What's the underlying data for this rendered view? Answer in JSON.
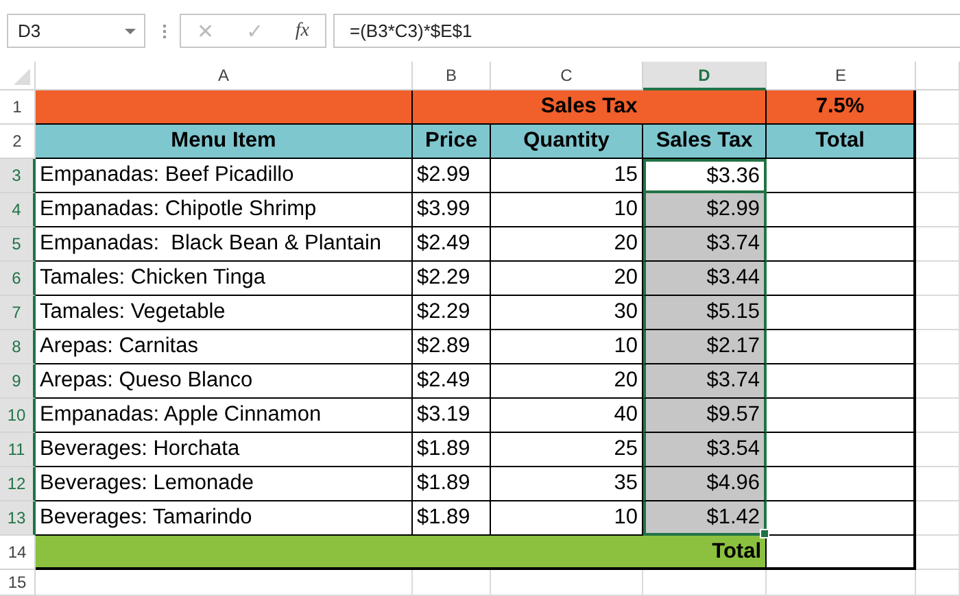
{
  "formula_bar": {
    "name_box": "D3",
    "cancel": "✕",
    "enter": "✓",
    "function": "fx",
    "formula": "=(B3*C3)*$E$1"
  },
  "columns": [
    {
      "label": "A",
      "selected": false
    },
    {
      "label": "B",
      "selected": false
    },
    {
      "label": "C",
      "selected": false
    },
    {
      "label": "D",
      "selected": true
    },
    {
      "label": "E",
      "selected": false
    }
  ],
  "rows": [
    {
      "kind": "title",
      "number": "1",
      "selected": false,
      "title": "Sales Tax",
      "rate": "7.5%"
    },
    {
      "kind": "header",
      "number": "2",
      "selected": false,
      "cells": [
        "Menu Item",
        "Price",
        "Quantity",
        "Sales Tax",
        "Total"
      ]
    },
    {
      "kind": "item",
      "number": "3",
      "selected": true,
      "item": "Empanadas: Beef Picadillo",
      "price": "$2.99",
      "quantity": "15",
      "sales_tax": "$3.36",
      "active": true
    },
    {
      "kind": "item",
      "number": "4",
      "selected": true,
      "item": "Empanadas: Chipotle Shrimp",
      "price": "$3.99",
      "quantity": "10",
      "sales_tax": "$2.99",
      "active": false
    },
    {
      "kind": "item",
      "number": "5",
      "selected": true,
      "item": "Empanadas:  Black Bean & Plantain",
      "price": "$2.49",
      "quantity": "20",
      "sales_tax": "$3.74",
      "active": false
    },
    {
      "kind": "item",
      "number": "6",
      "selected": true,
      "item": "Tamales: Chicken Tinga",
      "price": "$2.29",
      "quantity": "20",
      "sales_tax": "$3.44",
      "active": false
    },
    {
      "kind": "item",
      "number": "7",
      "selected": true,
      "item": "Tamales: Vegetable",
      "price": "$2.29",
      "quantity": "30",
      "sales_tax": "$5.15",
      "active": false
    },
    {
      "kind": "item",
      "number": "8",
      "selected": true,
      "item": "Arepas: Carnitas",
      "price": "$2.89",
      "quantity": "10",
      "sales_tax": "$2.17",
      "active": false
    },
    {
      "kind": "item",
      "number": "9",
      "selected": true,
      "item": "Arepas: Queso Blanco",
      "price": "$2.49",
      "quantity": "20",
      "sales_tax": "$3.74",
      "active": false
    },
    {
      "kind": "item",
      "number": "10",
      "selected": true,
      "item": "Empanadas: Apple Cinnamon",
      "price": "$3.19",
      "quantity": "40",
      "sales_tax": "$9.57",
      "active": false
    },
    {
      "kind": "item",
      "number": "11",
      "selected": true,
      "item": "Beverages: Horchata",
      "price": "$1.89",
      "quantity": "25",
      "sales_tax": "$3.54",
      "active": false
    },
    {
      "kind": "item",
      "number": "12",
      "selected": true,
      "item": "Beverages: Lemonade",
      "price": "$1.89",
      "quantity": "35",
      "sales_tax": "$4.96",
      "active": false
    },
    {
      "kind": "item",
      "number": "13",
      "selected": true,
      "item": "Beverages: Tamarindo",
      "price": "$1.89",
      "quantity": "10",
      "sales_tax": "$1.42",
      "active": false
    },
    {
      "kind": "total",
      "number": "14",
      "selected": false,
      "label": "Total"
    },
    {
      "kind": "blank",
      "number": "15",
      "selected": false
    }
  ]
}
